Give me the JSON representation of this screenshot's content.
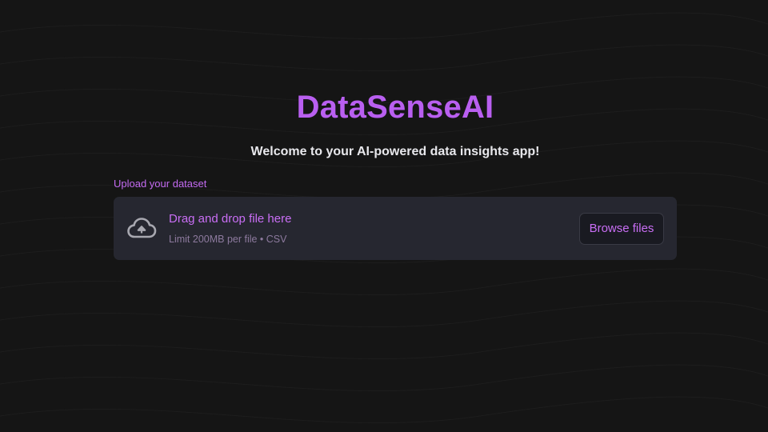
{
  "app": {
    "title": "DataSenseAI",
    "subtitle": "Welcome to your AI-powered data insights app!"
  },
  "uploader": {
    "label": "Upload your dataset",
    "drop_text": "Drag and drop file here",
    "limit_text": "Limit 200MB per file • CSV",
    "browse_label": "Browse files",
    "icon": "cloud-upload-icon"
  },
  "colors": {
    "background": "#151515",
    "accent": "#b95ff0",
    "dropzone": "#262730"
  }
}
